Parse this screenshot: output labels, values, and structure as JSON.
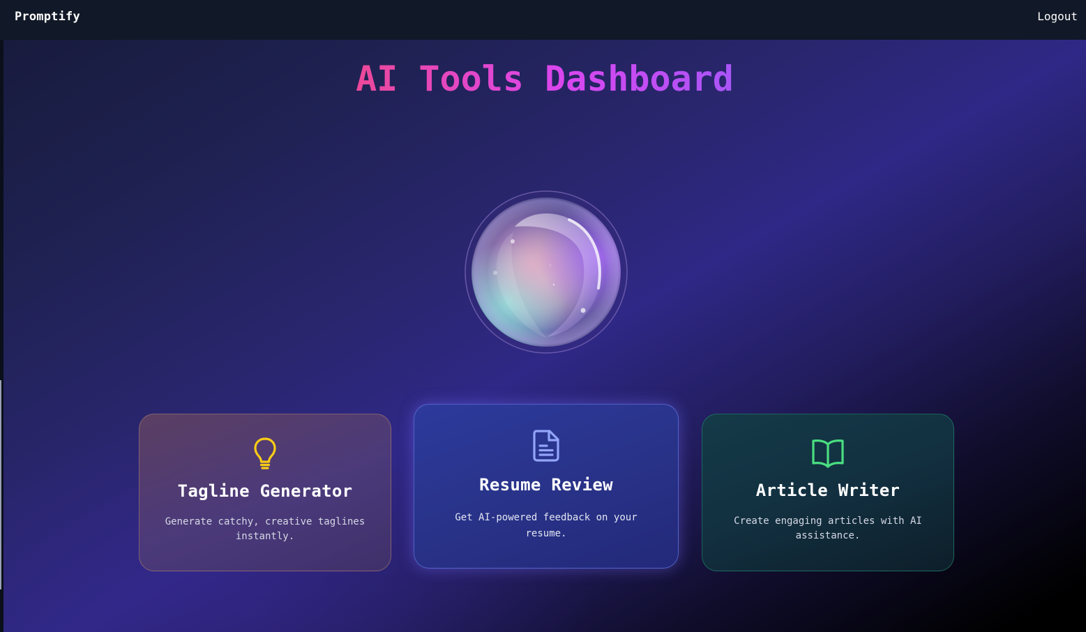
{
  "nav": {
    "brand": "Promptify",
    "logout_label": "Logout"
  },
  "main": {
    "title": "AI Tools Dashboard"
  },
  "cards": [
    {
      "title": "Tagline Generator",
      "description": "Generate catchy, creative taglines instantly.",
      "icon": "lightbulb-icon",
      "accent": "#facc15"
    },
    {
      "title": "Resume Review",
      "description": "Get AI-powered feedback on your resume.",
      "icon": "document-icon",
      "accent": "#93a5f8"
    },
    {
      "title": "Article Writer",
      "description": "Create engaging articles with AI assistance.",
      "icon": "open-book-icon",
      "accent": "#4ade80"
    }
  ],
  "colors": {
    "title_gradient": [
      "#ec4899",
      "#d946ef",
      "#a855f7"
    ],
    "navbar_bg": "#111827"
  }
}
